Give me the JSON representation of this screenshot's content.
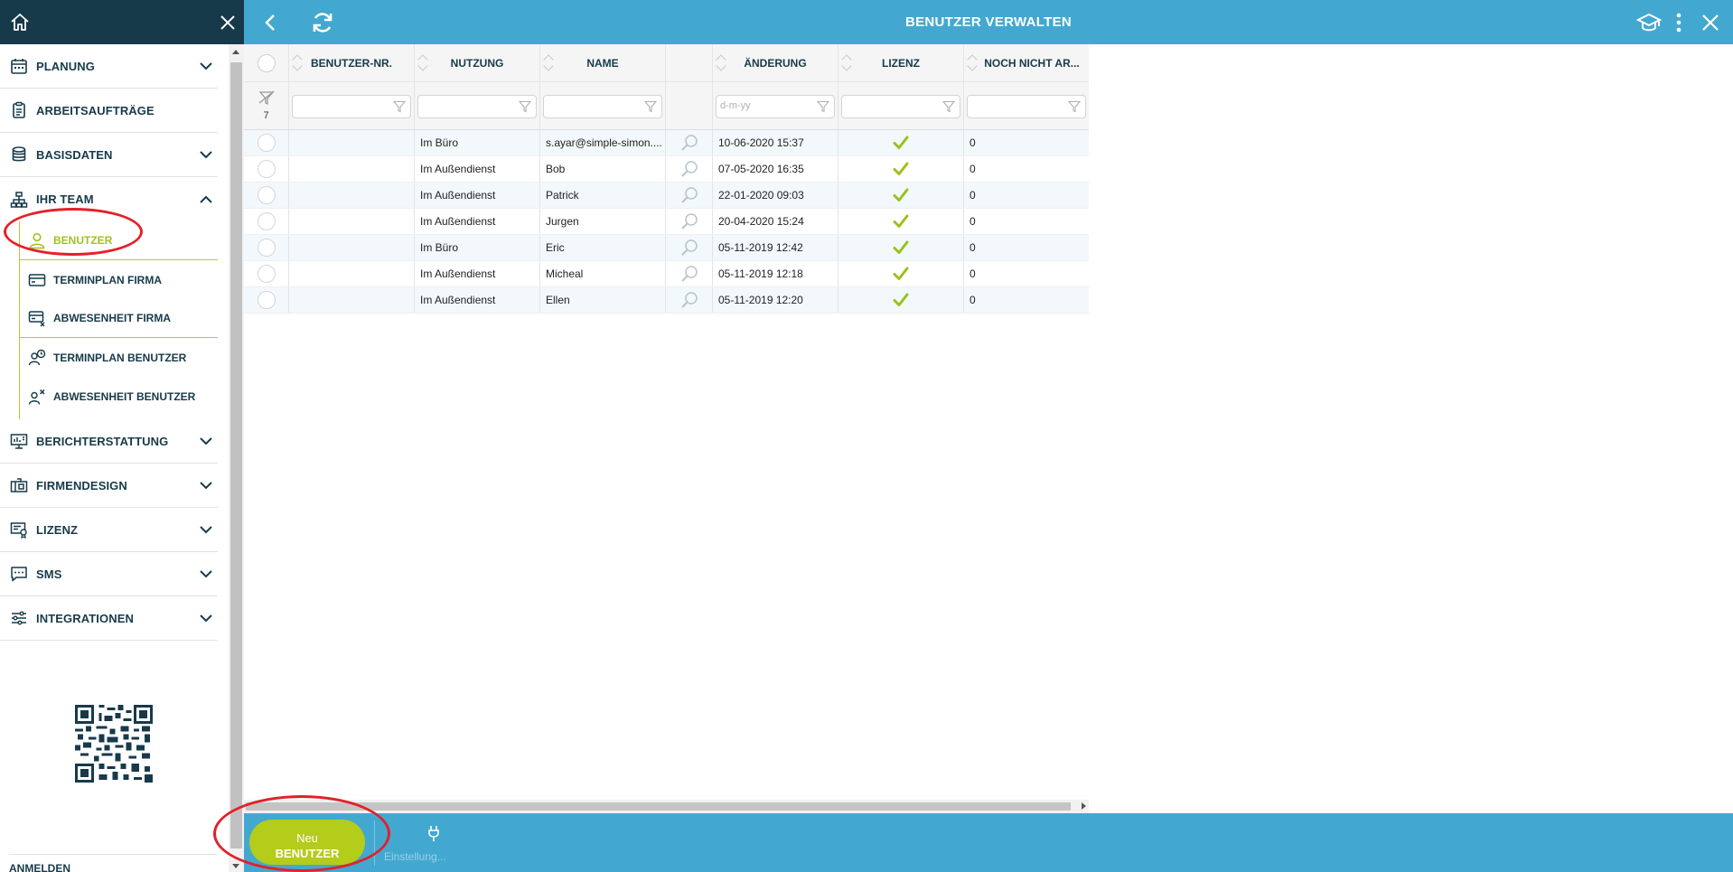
{
  "header": {
    "title": "BENUTZER VERWALTEN"
  },
  "sidebar": {
    "items": [
      {
        "label": "PLANUNG",
        "icon": "calendar-icon",
        "expandable": true
      },
      {
        "label": "ARBEITSAUFTRÄGE",
        "icon": "clipboard-icon",
        "expandable": false
      },
      {
        "label": "BASISDATEN",
        "icon": "database-icon",
        "expandable": true
      },
      {
        "label": "IHR TEAM",
        "icon": "org-chart-icon",
        "expandable": true,
        "expanded": true
      }
    ],
    "team_sub": [
      {
        "label": "BENUTZER",
        "icon": "user-icon",
        "active": true
      },
      {
        "label": "TERMINPLAN FIRMA",
        "icon": "card-icon"
      },
      {
        "label": "ABWESENHEIT FIRMA",
        "icon": "card-x-icon"
      },
      {
        "label": "TERMINPLAN BENUTZER",
        "icon": "user-clock-icon"
      },
      {
        "label": "ABWESENHEIT BENUTZER",
        "icon": "user-x-icon"
      }
    ],
    "items_after": [
      {
        "label": "BERICHTERSTATTUNG",
        "icon": "report-icon"
      },
      {
        "label": "FIRMENDESIGN",
        "icon": "design-icon"
      },
      {
        "label": "LIZENZ",
        "icon": "license-icon"
      },
      {
        "label": "SMS",
        "icon": "sms-icon"
      },
      {
        "label": "INTEGRATIONEN",
        "icon": "sliders-icon"
      }
    ],
    "bottom_label": "ANMELDEN"
  },
  "grid": {
    "columns": [
      "",
      "BENUTZER-NR.",
      "NUTZUNG",
      "NAME",
      "",
      "ÄNDERUNG",
      "LIZENZ",
      "NOCH NICHT AR..."
    ],
    "filter_count": "7",
    "date_placeholder": "d-m-yy",
    "rows": [
      {
        "nr": "",
        "nutzung": "Im Büro",
        "name": "s.ayar@simple-simon....",
        "aenderung": "10-06-2020 15:37",
        "lizenz": true,
        "noch": "0"
      },
      {
        "nr": "",
        "nutzung": "Im Außendienst",
        "name": "Bob",
        "aenderung": "07-05-2020 16:35",
        "lizenz": true,
        "noch": "0"
      },
      {
        "nr": "",
        "nutzung": "Im Außendienst",
        "name": "Patrick",
        "aenderung": "22-01-2020 09:03",
        "lizenz": true,
        "noch": "0"
      },
      {
        "nr": "",
        "nutzung": "Im Außendienst",
        "name": "Jurgen",
        "aenderung": "20-04-2020 15:24",
        "lizenz": true,
        "noch": "0"
      },
      {
        "nr": "",
        "nutzung": "Im Büro",
        "name": "Eric",
        "aenderung": "05-11-2019 12:42",
        "lizenz": true,
        "noch": "0"
      },
      {
        "nr": "",
        "nutzung": "Im Außendienst",
        "name": "Micheal",
        "aenderung": "05-11-2019 12:18",
        "lizenz": true,
        "noch": "0"
      },
      {
        "nr": "",
        "nutzung": "Im Außendienst",
        "name": "Ellen",
        "aenderung": "05-11-2019 12:20",
        "lizenz": true,
        "noch": "0"
      }
    ]
  },
  "footer": {
    "new_line1": "Neu",
    "new_line2": "BENUTZER",
    "settings_label": "Einstellung..."
  },
  "colors": {
    "header": "#43a8d0",
    "sidebar_top": "#173a4a",
    "accent": "#b4cc1a",
    "annotation": "#e3202a"
  }
}
